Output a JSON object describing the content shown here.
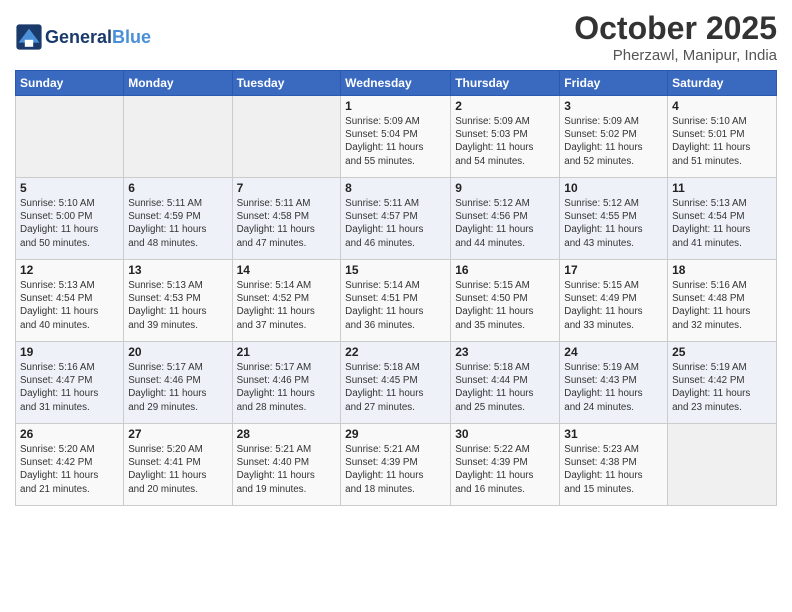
{
  "header": {
    "logo_general": "General",
    "logo_blue": "Blue",
    "month_title": "October 2025",
    "location": "Pherzawl, Manipur, India"
  },
  "days_of_week": [
    "Sunday",
    "Monday",
    "Tuesday",
    "Wednesday",
    "Thursday",
    "Friday",
    "Saturday"
  ],
  "weeks": [
    [
      {
        "day": "",
        "info": ""
      },
      {
        "day": "",
        "info": ""
      },
      {
        "day": "",
        "info": ""
      },
      {
        "day": "1",
        "info": "Sunrise: 5:09 AM\nSunset: 5:04 PM\nDaylight: 11 hours\nand 55 minutes."
      },
      {
        "day": "2",
        "info": "Sunrise: 5:09 AM\nSunset: 5:03 PM\nDaylight: 11 hours\nand 54 minutes."
      },
      {
        "day": "3",
        "info": "Sunrise: 5:09 AM\nSunset: 5:02 PM\nDaylight: 11 hours\nand 52 minutes."
      },
      {
        "day": "4",
        "info": "Sunrise: 5:10 AM\nSunset: 5:01 PM\nDaylight: 11 hours\nand 51 minutes."
      }
    ],
    [
      {
        "day": "5",
        "info": "Sunrise: 5:10 AM\nSunset: 5:00 PM\nDaylight: 11 hours\nand 50 minutes."
      },
      {
        "day": "6",
        "info": "Sunrise: 5:11 AM\nSunset: 4:59 PM\nDaylight: 11 hours\nand 48 minutes."
      },
      {
        "day": "7",
        "info": "Sunrise: 5:11 AM\nSunset: 4:58 PM\nDaylight: 11 hours\nand 47 minutes."
      },
      {
        "day": "8",
        "info": "Sunrise: 5:11 AM\nSunset: 4:57 PM\nDaylight: 11 hours\nand 46 minutes."
      },
      {
        "day": "9",
        "info": "Sunrise: 5:12 AM\nSunset: 4:56 PM\nDaylight: 11 hours\nand 44 minutes."
      },
      {
        "day": "10",
        "info": "Sunrise: 5:12 AM\nSunset: 4:55 PM\nDaylight: 11 hours\nand 43 minutes."
      },
      {
        "day": "11",
        "info": "Sunrise: 5:13 AM\nSunset: 4:54 PM\nDaylight: 11 hours\nand 41 minutes."
      }
    ],
    [
      {
        "day": "12",
        "info": "Sunrise: 5:13 AM\nSunset: 4:54 PM\nDaylight: 11 hours\nand 40 minutes."
      },
      {
        "day": "13",
        "info": "Sunrise: 5:13 AM\nSunset: 4:53 PM\nDaylight: 11 hours\nand 39 minutes."
      },
      {
        "day": "14",
        "info": "Sunrise: 5:14 AM\nSunset: 4:52 PM\nDaylight: 11 hours\nand 37 minutes."
      },
      {
        "day": "15",
        "info": "Sunrise: 5:14 AM\nSunset: 4:51 PM\nDaylight: 11 hours\nand 36 minutes."
      },
      {
        "day": "16",
        "info": "Sunrise: 5:15 AM\nSunset: 4:50 PM\nDaylight: 11 hours\nand 35 minutes."
      },
      {
        "day": "17",
        "info": "Sunrise: 5:15 AM\nSunset: 4:49 PM\nDaylight: 11 hours\nand 33 minutes."
      },
      {
        "day": "18",
        "info": "Sunrise: 5:16 AM\nSunset: 4:48 PM\nDaylight: 11 hours\nand 32 minutes."
      }
    ],
    [
      {
        "day": "19",
        "info": "Sunrise: 5:16 AM\nSunset: 4:47 PM\nDaylight: 11 hours\nand 31 minutes."
      },
      {
        "day": "20",
        "info": "Sunrise: 5:17 AM\nSunset: 4:46 PM\nDaylight: 11 hours\nand 29 minutes."
      },
      {
        "day": "21",
        "info": "Sunrise: 5:17 AM\nSunset: 4:46 PM\nDaylight: 11 hours\nand 28 minutes."
      },
      {
        "day": "22",
        "info": "Sunrise: 5:18 AM\nSunset: 4:45 PM\nDaylight: 11 hours\nand 27 minutes."
      },
      {
        "day": "23",
        "info": "Sunrise: 5:18 AM\nSunset: 4:44 PM\nDaylight: 11 hours\nand 25 minutes."
      },
      {
        "day": "24",
        "info": "Sunrise: 5:19 AM\nSunset: 4:43 PM\nDaylight: 11 hours\nand 24 minutes."
      },
      {
        "day": "25",
        "info": "Sunrise: 5:19 AM\nSunset: 4:42 PM\nDaylight: 11 hours\nand 23 minutes."
      }
    ],
    [
      {
        "day": "26",
        "info": "Sunrise: 5:20 AM\nSunset: 4:42 PM\nDaylight: 11 hours\nand 21 minutes."
      },
      {
        "day": "27",
        "info": "Sunrise: 5:20 AM\nSunset: 4:41 PM\nDaylight: 11 hours\nand 20 minutes."
      },
      {
        "day": "28",
        "info": "Sunrise: 5:21 AM\nSunset: 4:40 PM\nDaylight: 11 hours\nand 19 minutes."
      },
      {
        "day": "29",
        "info": "Sunrise: 5:21 AM\nSunset: 4:39 PM\nDaylight: 11 hours\nand 18 minutes."
      },
      {
        "day": "30",
        "info": "Sunrise: 5:22 AM\nSunset: 4:39 PM\nDaylight: 11 hours\nand 16 minutes."
      },
      {
        "day": "31",
        "info": "Sunrise: 5:23 AM\nSunset: 4:38 PM\nDaylight: 11 hours\nand 15 minutes."
      },
      {
        "day": "",
        "info": ""
      }
    ]
  ]
}
